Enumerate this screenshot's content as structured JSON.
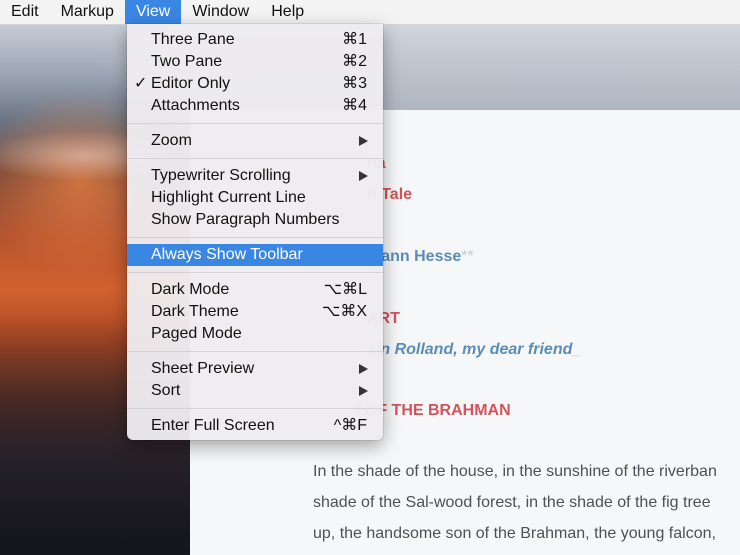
{
  "menubar": {
    "items": [
      {
        "label": "Edit"
      },
      {
        "label": "Markup"
      },
      {
        "label": "View"
      },
      {
        "label": "Window"
      },
      {
        "label": "Help"
      }
    ],
    "active": "View"
  },
  "view_menu": {
    "group1": [
      {
        "label": "Three Pane",
        "shortcut": "⌘1",
        "checked": false
      },
      {
        "label": "Two Pane",
        "shortcut": "⌘2",
        "checked": false
      },
      {
        "label": "Editor Only",
        "shortcut": "⌘3",
        "checked": true,
        "check": "✓"
      },
      {
        "label": "Attachments",
        "shortcut": "⌘4",
        "checked": false
      }
    ],
    "zoom": {
      "label": "Zoom",
      "submenu": true
    },
    "group3": [
      {
        "label": "Typewriter Scrolling",
        "submenu": true
      },
      {
        "label": "Highlight Current Line"
      },
      {
        "label": "Show Paragraph Numbers"
      }
    ],
    "always_show_toolbar": {
      "label": "Always Show Toolbar",
      "highlighted": true
    },
    "group5": [
      {
        "label": "Dark Mode",
        "shortcut": "⌥⌘L"
      },
      {
        "label": "Dark Theme",
        "shortcut": "⌥⌘X"
      },
      {
        "label": "Paged Mode"
      }
    ],
    "group6": [
      {
        "label": "Sheet Preview",
        "submenu": true
      },
      {
        "label": "Sort",
        "submenu": true
      }
    ],
    "full_screen": {
      "label": "Enter Full Screen",
      "shortcut": "^⌘F"
    }
  },
  "document": {
    "title_fragment": "ha",
    "subtitle_fragment": "n Tale",
    "author_fragment": "mann Hesse",
    "author_marker": "**",
    "part_fragment": "ART",
    "dedication_fragment": "ain Rolland, my dear friend",
    "dedication_marker": "_",
    "chapter_fragment": "I OF THE BRAHMAN",
    "paragraph_lines": [
      "In the shade of the house, in the sunshine of the riverban",
      "shade of the Sal-wood forest, in the shade of the fig tree",
      "up, the handsome son of the Brahman, the young falcon,"
    ]
  }
}
